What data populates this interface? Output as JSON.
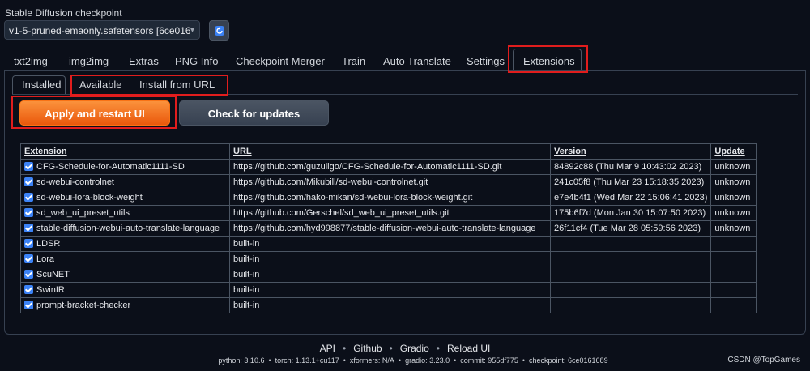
{
  "checkpoint": {
    "label": "Stable Diffusion checkpoint",
    "value": "v1-5-pruned-emaonly.safetensors [6ce016"
  },
  "tabs": [
    "txt2img",
    "img2img",
    "Extras",
    "PNG Info",
    "Checkpoint Merger",
    "Train",
    "Auto Translate",
    "Settings",
    "Extensions"
  ],
  "subtabs": [
    "Installed",
    "Available",
    "Install from URL"
  ],
  "buttons": {
    "apply": "Apply and restart UI",
    "check": "Check for updates"
  },
  "table": {
    "headers": [
      "Extension",
      "URL",
      "Version",
      "Update"
    ],
    "rows": [
      {
        "name": "CFG-Schedule-for-Automatic1111-SD",
        "url": "https://github.com/guzuligo/CFG-Schedule-for-Automatic1111-SD.git",
        "version": "84892c88 (Thu Mar 9 10:43:02 2023)",
        "update": "unknown"
      },
      {
        "name": "sd-webui-controlnet",
        "url": "https://github.com/Mikubill/sd-webui-controlnet.git",
        "version": "241c05f8 (Thu Mar 23 15:18:35 2023)",
        "update": "unknown"
      },
      {
        "name": "sd-webui-lora-block-weight",
        "url": "https://github.com/hako-mikan/sd-webui-lora-block-weight.git",
        "version": "e7e4b4f1 (Wed Mar 22 15:06:41 2023)",
        "update": "unknown"
      },
      {
        "name": "sd_web_ui_preset_utils",
        "url": "https://github.com/Gerschel/sd_web_ui_preset_utils.git",
        "version": "175b6f7d (Mon Jan 30 15:07:50 2023)",
        "update": "unknown"
      },
      {
        "name": "stable-diffusion-webui-auto-translate-language",
        "url": "https://github.com/hyd998877/stable-diffusion-webui-auto-translate-language",
        "version": "26f11cf4 (Tue Mar 28 05:59:56 2023)",
        "update": "unknown"
      },
      {
        "name": "LDSR",
        "url": "built-in",
        "version": "",
        "update": ""
      },
      {
        "name": "Lora",
        "url": "built-in",
        "version": "",
        "update": ""
      },
      {
        "name": "ScuNET",
        "url": "built-in",
        "version": "",
        "update": ""
      },
      {
        "name": "SwinIR",
        "url": "built-in",
        "version": "",
        "update": ""
      },
      {
        "name": "prompt-bracket-checker",
        "url": "built-in",
        "version": "",
        "update": ""
      }
    ]
  },
  "footer": {
    "links": [
      "API",
      "Github",
      "Gradio",
      "Reload UI"
    ],
    "info": [
      "python: 3.10.6",
      "torch: 1.13.1+cu117",
      "xformers: N/A",
      "gradio: 3.23.0",
      "commit: 955df775",
      "checkpoint: 6ce0161689"
    ]
  },
  "watermark": "CSDN @TopGames",
  "colors": {
    "accent": "#ea580c",
    "highlight": "#e11d1d",
    "checkbox": "#3b82f6"
  }
}
